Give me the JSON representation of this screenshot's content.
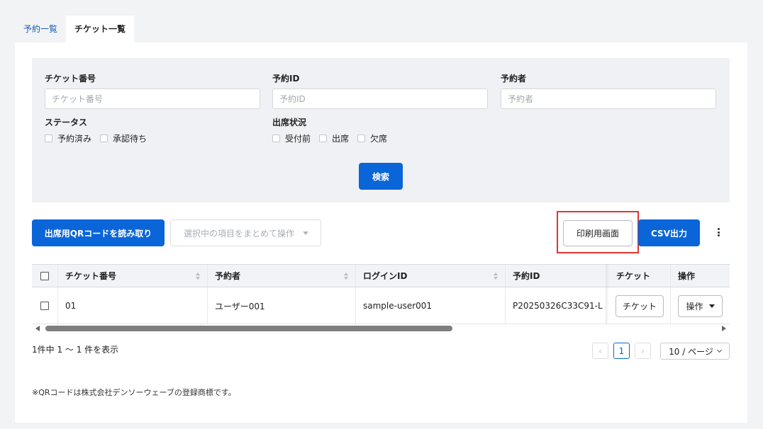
{
  "tabs": [
    {
      "label": "予約一覧"
    },
    {
      "label": "チケット一覧"
    }
  ],
  "search": {
    "ticket_no": {
      "label": "チケット番号",
      "placeholder": "チケット番号"
    },
    "reservation_id": {
      "label": "予約ID",
      "placeholder": "予約ID"
    },
    "reserver": {
      "label": "予約者",
      "placeholder": "予約者"
    },
    "status": {
      "label": "ステータス",
      "options": [
        "予約済み",
        "承認待ち"
      ]
    },
    "attendance": {
      "label": "出席状況",
      "options": [
        "受付前",
        "出席",
        "欠席"
      ]
    },
    "submit_label": "検索"
  },
  "toolbar": {
    "scan_qr_label": "出席用QRコードを読み取り",
    "bulk_action_placeholder": "選択中の項目をまとめて操作",
    "print_label": "印刷用画面",
    "csv_label": "CSV出力"
  },
  "table": {
    "columns": [
      "チケット番号",
      "予約者",
      "ログインID",
      "予約ID",
      "チケット",
      "操作"
    ],
    "rows": [
      {
        "ticket_no": "01",
        "reserver": "ユーザー001",
        "login_id": "sample-user001",
        "reservation_id": "P20250326C33C91-L",
        "ticket_button": "チケット",
        "action_button": "操作"
      }
    ]
  },
  "pagination": {
    "summary": "1件中 1 〜 1 件を表示",
    "prev": "‹",
    "current_page": "1",
    "next": "›",
    "per_page": "10 / ページ"
  },
  "footnote": "※QRコードは株式会社デンソーウェーブの登録商標です。",
  "colors": {
    "primary": "#0a65d8",
    "highlight": "#e3342f",
    "tab_link": "#1a5fb4"
  }
}
